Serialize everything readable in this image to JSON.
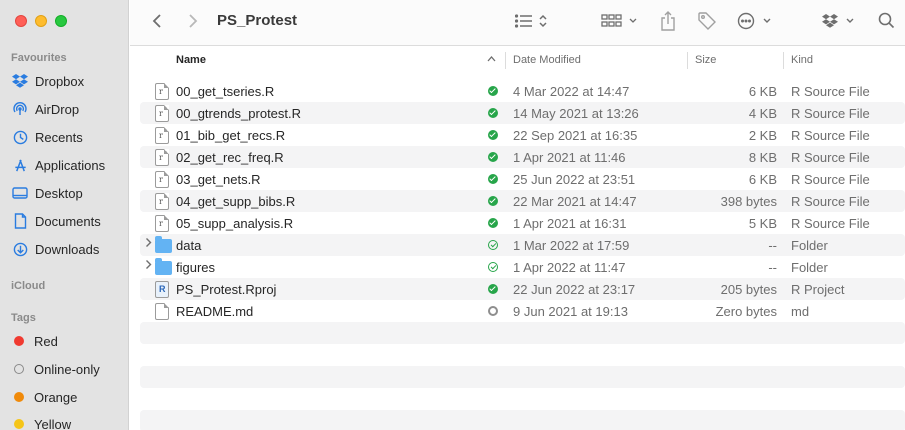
{
  "window": {
    "title": "PS_Protest"
  },
  "sidebar": {
    "favourites_title": "Favourites",
    "favourites": [
      {
        "label": "Dropbox",
        "icon": "dropbox-icon"
      },
      {
        "label": "AirDrop",
        "icon": "airdrop-icon"
      },
      {
        "label": "Recents",
        "icon": "clock-icon"
      },
      {
        "label": "Applications",
        "icon": "applications-icon"
      },
      {
        "label": "Desktop",
        "icon": "desktop-icon"
      },
      {
        "label": "Documents",
        "icon": "document-icon"
      },
      {
        "label": "Downloads",
        "icon": "download-icon"
      }
    ],
    "icloud_title": "iCloud",
    "tags_title": "Tags",
    "tags": [
      {
        "label": "Red",
        "color": "#f03a30"
      },
      {
        "label": "Online-only",
        "color": "none"
      },
      {
        "label": "Orange",
        "color": "#f08a0a"
      },
      {
        "label": "Yellow",
        "color": "#f5c518"
      }
    ]
  },
  "columns": {
    "name": "Name",
    "date": "Date Modified",
    "size": "Size",
    "kind": "Kind"
  },
  "files": [
    {
      "name": "00_get_tseries.R",
      "date": "4 Mar 2022 at 14:47",
      "size": "6 KB",
      "kind": "R Source File",
      "type": "r",
      "status": "synced"
    },
    {
      "name": "00_gtrends_protest.R",
      "date": "14 May 2021 at 13:26",
      "size": "4 KB",
      "kind": "R Source File",
      "type": "r",
      "status": "synced"
    },
    {
      "name": "01_bib_get_recs.R",
      "date": "22 Sep 2021 at 16:35",
      "size": "2 KB",
      "kind": "R Source File",
      "type": "r",
      "status": "synced"
    },
    {
      "name": "02_get_rec_freq.R",
      "date": "1 Apr 2021 at 11:46",
      "size": "8 KB",
      "kind": "R Source File",
      "type": "r",
      "status": "synced"
    },
    {
      "name": "03_get_nets.R",
      "date": "25 Jun 2022 at 23:51",
      "size": "6 KB",
      "kind": "R Source File",
      "type": "r",
      "status": "synced"
    },
    {
      "name": "04_get_supp_bibs.R",
      "date": "22 Mar 2021 at 14:47",
      "size": "398 bytes",
      "kind": "R Source File",
      "type": "r",
      "status": "synced"
    },
    {
      "name": "05_supp_analysis.R",
      "date": "1 Apr 2021 at 16:31",
      "size": "5 KB",
      "kind": "R Source File",
      "type": "r",
      "status": "synced"
    },
    {
      "name": "data",
      "date": "1 Mar 2022 at 17:59",
      "size": "--",
      "kind": "Folder",
      "type": "folder",
      "status": "outline"
    },
    {
      "name": "figures",
      "date": "1 Apr 2022 at 11:47",
      "size": "--",
      "kind": "Folder",
      "type": "folder",
      "status": "outline"
    },
    {
      "name": "PS_Protest.Rproj",
      "date": "22 Jun 2022 at 23:17",
      "size": "205 bytes",
      "kind": "R Project",
      "type": "rproj",
      "status": "synced"
    },
    {
      "name": "README.md",
      "date": "9 Jun 2021 at 19:13",
      "size": "Zero bytes",
      "kind": "md",
      "type": "md",
      "status": "syncing"
    }
  ]
}
